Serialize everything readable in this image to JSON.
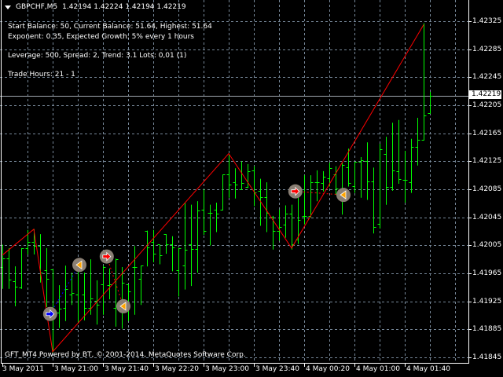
{
  "header": {
    "symbol": "GBPCHF,M5",
    "ohlc": "1.42194 1.42224 1.42194 1.42219"
  },
  "info": {
    "line1": "Start Balance: 50, Current Balance: 51.64, Highest: 51.64",
    "line2": "Exponent: 0.35, Expected Growth: 5% every 1 hours",
    "line3": "Leverage: 500, Spread: 2, Trend: 3.1 Lots: 0,01 (1)",
    "line4": "Trade Hours: 21 - 1"
  },
  "footer": "GFT_MT4 Powered by BT, © 2001-2014, MetaQuotes Software Corp.",
  "colors": {
    "bars": "#00ff00",
    "zigzag": "#ff0000",
    "grid": "#778899",
    "background": "#000000"
  },
  "chart_data": {
    "type": "ohlc",
    "symbol": "GBPCHF",
    "timeframe": "M5",
    "current_price": "1.42219",
    "price_labels": [
      "1.42325",
      "1.42285",
      "1.42245",
      "1.42205",
      "1.42165",
      "1.42125",
      "1.42085",
      "1.42045",
      "1.42005",
      "1.41965",
      "1.41925",
      "1.41885",
      "1.41845"
    ],
    "time_labels": [
      "3 May 2011",
      "3 May 21:00",
      "3 May 21:40",
      "3 May 22:20",
      "3 May 23:00",
      "3 May 23:40",
      "4 May 00:20",
      "4 May 01:00",
      "4 May 01:40"
    ],
    "ylim": [
      1.41845,
      1.42325
    ],
    "bars_ohlc": [
      [
        1.41974,
        1.42006,
        1.41944,
        1.41986
      ],
      [
        1.41986,
        1.42001,
        1.41944,
        1.41956
      ],
      [
        1.41954,
        1.41975,
        1.41919,
        1.41946
      ],
      [
        1.41945,
        1.42001,
        1.41944,
        1.42001
      ],
      [
        1.42001,
        1.42027,
        1.41993,
        1.4201
      ],
      [
        1.4201,
        1.42028,
        1.41993,
        1.42004
      ],
      [
        1.42004,
        1.42021,
        1.41953,
        1.41966
      ],
      [
        1.41969,
        1.42001,
        1.41918,
        1.41957
      ],
      [
        1.41971,
        1.41971,
        1.41853,
        1.41909
      ],
      [
        1.41909,
        1.41948,
        1.41888,
        1.41915
      ],
      [
        1.41916,
        1.41976,
        1.41898,
        1.41943
      ],
      [
        1.41935,
        1.41966,
        1.41921,
        1.41937
      ],
      [
        1.41935,
        1.41974,
        1.41896,
        1.41974
      ],
      [
        1.41935,
        1.41966,
        1.41899,
        1.41916
      ],
      [
        1.41916,
        1.41985,
        1.41907,
        1.41929
      ],
      [
        1.41926,
        1.41955,
        1.41893,
        1.4192
      ],
      [
        1.41949,
        1.41976,
        1.41907,
        1.41974
      ],
      [
        1.41948,
        1.41972,
        1.41929,
        1.41949
      ],
      [
        1.41916,
        1.41986,
        1.4189,
        1.41985
      ],
      [
        1.4191,
        1.41974,
        1.41887,
        1.41952
      ],
      [
        1.41949,
        1.41949,
        1.41898,
        1.41939
      ],
      [
        1.41974,
        1.42004,
        1.41907,
        1.41974
      ],
      [
        1.41957,
        1.41976,
        1.41921,
        1.41976
      ],
      [
        1.42026,
        1.42026,
        1.41976,
        1.42002
      ],
      [
        1.4201,
        1.42027,
        1.41982,
        1.41993
      ],
      [
        1.42006,
        1.42006,
        1.41979,
        1.41991
      ],
      [
        1.42021,
        1.42021,
        1.41994,
        1.42006
      ],
      [
        1.42006,
        1.42018,
        1.41969,
        1.42002
      ],
      [
        1.41969,
        1.42001,
        1.41933,
        1.42001
      ],
      [
        1.41976,
        1.42066,
        1.41943,
        1.41999
      ],
      [
        1.42006,
        1.42063,
        1.41948,
        1.42
      ],
      [
        1.42,
        1.42068,
        1.41967,
        1.42055
      ],
      [
        1.42056,
        1.42085,
        1.42021,
        1.42026
      ],
      [
        1.42051,
        1.42063,
        1.42006,
        1.42051
      ],
      [
        1.42056,
        1.42066,
        1.42025,
        1.4205
      ],
      [
        1.42056,
        1.42106,
        1.42056,
        1.42106
      ],
      [
        1.42106,
        1.42134,
        1.42074,
        1.42092
      ],
      [
        1.42095,
        1.42115,
        1.42073,
        1.42092
      ],
      [
        1.42085,
        1.42125,
        1.42085,
        1.42094
      ],
      [
        1.42088,
        1.42121,
        1.42088,
        1.42111
      ],
      [
        1.42112,
        1.42118,
        1.42062,
        1.42081
      ],
      [
        1.42083,
        1.421,
        1.42034,
        1.42074
      ],
      [
        1.42074,
        1.42095,
        1.42025,
        1.42051
      ],
      [
        1.42046,
        1.42047,
        1.42,
        1.42026
      ],
      [
        1.42026,
        1.42056,
        1.42013,
        1.42031
      ],
      [
        1.42034,
        1.42062,
        1.42017,
        1.4205
      ],
      [
        1.4205,
        1.42063,
        1.42,
        1.42007
      ],
      [
        1.42013,
        1.42081,
        1.42008,
        1.42041
      ],
      [
        1.42047,
        1.42105,
        1.42036,
        1.42047
      ],
      [
        1.42047,
        1.42105,
        1.42046,
        1.42095
      ],
      [
        1.42095,
        1.42112,
        1.42069,
        1.42095
      ],
      [
        1.42094,
        1.42111,
        1.42083,
        1.42103
      ],
      [
        1.42101,
        1.42123,
        1.4209,
        1.42115
      ],
      [
        1.42106,
        1.42118,
        1.42078,
        1.42086
      ],
      [
        1.42086,
        1.42123,
        1.4205,
        1.4212
      ],
      [
        1.42116,
        1.42143,
        1.4209,
        1.42094
      ],
      [
        1.4209,
        1.42124,
        1.42081,
        1.42124
      ],
      [
        1.42124,
        1.42131,
        1.42074,
        1.42127
      ],
      [
        1.42125,
        1.42152,
        1.42071,
        1.42096
      ],
      [
        1.42096,
        1.42116,
        1.42023,
        1.42031
      ],
      [
        1.42036,
        1.4215,
        1.4203,
        1.42142
      ],
      [
        1.42136,
        1.4216,
        1.42064,
        1.42088
      ],
      [
        1.42088,
        1.4218,
        1.42084,
        1.42112
      ],
      [
        1.42111,
        1.42184,
        1.42094,
        1.421
      ],
      [
        1.42099,
        1.4214,
        1.42067,
        1.42099
      ],
      [
        1.42095,
        1.42157,
        1.42081,
        1.42146
      ],
      [
        1.42146,
        1.42187,
        1.4212,
        1.42156
      ],
      [
        1.42156,
        1.42322,
        1.42156,
        1.4219
      ],
      [
        1.42194,
        1.42224,
        1.42194,
        1.42219
      ]
    ],
    "zigzag": [
      [
        0,
        1.41991
      ],
      [
        5,
        1.42028
      ],
      [
        8,
        1.41853
      ],
      [
        36,
        1.42136
      ],
      [
        46,
        1.42001
      ],
      [
        67,
        1.4232
      ]
    ],
    "trade_markers": [
      {
        "bar": 7.6,
        "price": 1.41907,
        "kind": "buy-open",
        "color": "#0000ff"
      },
      {
        "bar": 12.25,
        "price": 1.41977,
        "kind": "close",
        "color": "#ffa500"
      },
      {
        "bar": 16.6,
        "price": 1.41989,
        "kind": "sell-open",
        "color": "#ff0000"
      },
      {
        "bar": 19.25,
        "price": 1.41918,
        "kind": "close",
        "color": "#ffa500"
      },
      {
        "bar": 46.6,
        "price": 1.42082,
        "kind": "sell-open",
        "color": "#ff0000"
      },
      {
        "bar": 54.25,
        "price": 1.42077,
        "kind": "close",
        "color": "#ffa500"
      }
    ]
  }
}
